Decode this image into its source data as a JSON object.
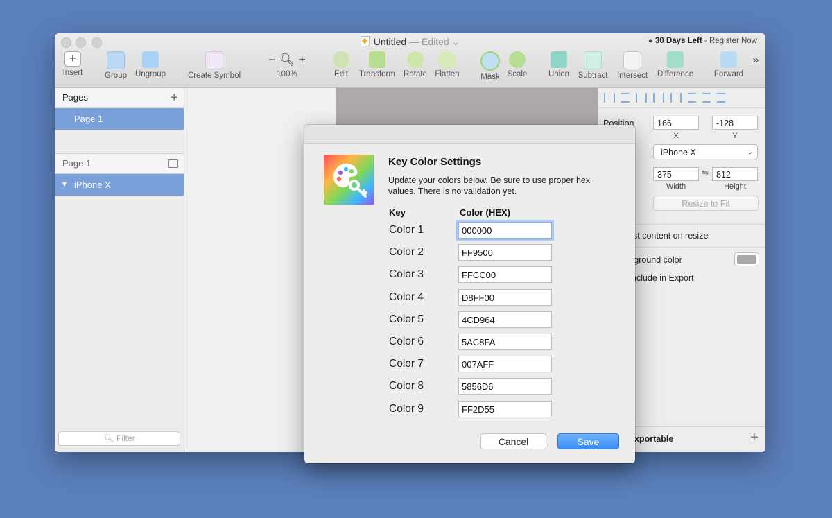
{
  "window": {
    "title": "Untitled",
    "edited": "— Edited ⌄",
    "trial_bullet": "●",
    "trial_days": "30 Days Left",
    "trial_sep": "-",
    "trial_link": "Register Now"
  },
  "toolbar": {
    "items": [
      {
        "label": "Insert"
      },
      {
        "label": "Group"
      },
      {
        "label": "Ungroup"
      },
      {
        "label": "Create Symbol"
      },
      {
        "label": "100%"
      },
      {
        "label": "Edit"
      },
      {
        "label": "Transform"
      },
      {
        "label": "Rotate"
      },
      {
        "label": "Flatten"
      },
      {
        "label": "Mask"
      },
      {
        "label": "Scale"
      },
      {
        "label": "Union"
      },
      {
        "label": "Subtract"
      },
      {
        "label": "Intersect"
      },
      {
        "label": "Difference"
      },
      {
        "label": "Forward"
      }
    ],
    "more": "»"
  },
  "sidebar": {
    "pages_header": "Pages",
    "selected_page": "Page 1",
    "layers_header": "Page 1",
    "selected_layer": "iPhone X",
    "filter_placeholder": "Filter"
  },
  "inspector": {
    "position_label": "Position",
    "x_value": "166",
    "y_value": "-128",
    "x_caption": "X",
    "y_caption": "Y",
    "device": "iPhone X",
    "width_value": "375",
    "height_value": "812",
    "width_caption": "Width",
    "height_caption": "Height",
    "resize_button": "Resize to Fit",
    "adjust_label": "st content on resize",
    "background_label": "kground color",
    "include_label": "nclude in Export",
    "exportable_label": "xportable"
  },
  "dialog": {
    "title": "Key Color Settings",
    "description": "Update your colors below. Be sure to use proper hex values. There is no validation yet.",
    "key_header": "Key",
    "color_header": "Color (HEX)",
    "rows": [
      {
        "label": "Color 1",
        "value": "000000"
      },
      {
        "label": "Color 2",
        "value": "FF9500"
      },
      {
        "label": "Color 3",
        "value": "FFCC00"
      },
      {
        "label": "Color 4",
        "value": "D8FF00"
      },
      {
        "label": "Color 5",
        "value": "4CD964"
      },
      {
        "label": "Color 6",
        "value": "5AC8FA"
      },
      {
        "label": "Color 7",
        "value": "007AFF"
      },
      {
        "label": "Color 8",
        "value": "5856D6"
      },
      {
        "label": "Color 9",
        "value": "FF2D55"
      }
    ],
    "cancel_label": "Cancel",
    "save_label": "Save"
  },
  "colors": {
    "desktop": "#5b7fbb",
    "selection": "#7ba1da",
    "primary_button": "#3a8ef7",
    "artboard": "#aea9a9"
  }
}
